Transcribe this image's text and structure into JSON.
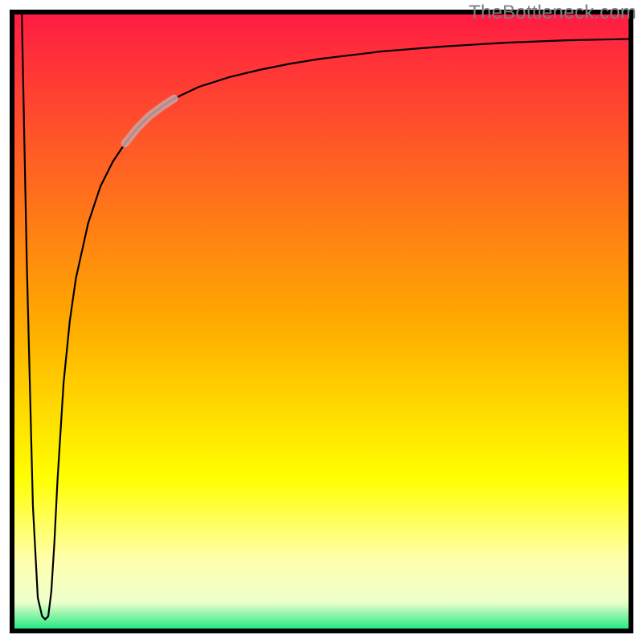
{
  "watermark": "TheBottleneck.com",
  "chart_data": {
    "type": "line",
    "title": "",
    "xlabel": "",
    "ylabel": "",
    "xlim": [
      0,
      100
    ],
    "ylim": [
      0,
      100
    ],
    "grid": false,
    "legend": false,
    "background_gradient": {
      "stops": [
        {
          "offset": 0.0,
          "color": "#ff1a44"
        },
        {
          "offset": 0.5,
          "color": "#ffaa00"
        },
        {
          "offset": 0.75,
          "color": "#ffff00"
        },
        {
          "offset": 0.88,
          "color": "#ffffaa"
        },
        {
          "offset": 0.95,
          "color": "#eeffcc"
        },
        {
          "offset": 1.0,
          "color": "#00e676"
        }
      ]
    },
    "frame_stroke": "#000000",
    "frame_stroke_width": 6,
    "series": [
      {
        "name": "bottleneck-curve",
        "color": "#000000",
        "width": 2.2,
        "x": [
          1.2,
          2.0,
          3.0,
          3.8,
          4.5,
          5.0,
          5.5,
          6.0,
          6.5,
          7.0,
          8.0,
          9.0,
          10.0,
          12.0,
          14.0,
          16.0,
          18.0,
          20.0,
          22.0,
          24.0,
          26.0,
          30.0,
          35.0,
          40.0,
          45.0,
          50.0,
          55.0,
          60.0,
          65.0,
          70.0,
          75.0,
          80.0,
          85.0,
          90.0,
          95.0,
          100.0
        ],
        "y": [
          100.0,
          60.0,
          20.0,
          5.0,
          2.0,
          1.5,
          2.0,
          6.0,
          14.0,
          24.0,
          40.0,
          50.0,
          57.0,
          66.0,
          72.0,
          76.0,
          79.0,
          81.5,
          83.5,
          85.0,
          86.3,
          88.2,
          89.8,
          91.0,
          92.0,
          92.8,
          93.4,
          94.0,
          94.4,
          94.8,
          95.1,
          95.4,
          95.6,
          95.8,
          95.9,
          96.0
        ]
      },
      {
        "name": "highlight-segment",
        "color": "#caa3a3",
        "opacity": 0.85,
        "width": 10,
        "x": [
          18.0,
          20.0,
          22.0,
          24.0,
          26.0
        ],
        "y": [
          79.0,
          81.5,
          83.5,
          85.0,
          86.3
        ]
      }
    ]
  }
}
